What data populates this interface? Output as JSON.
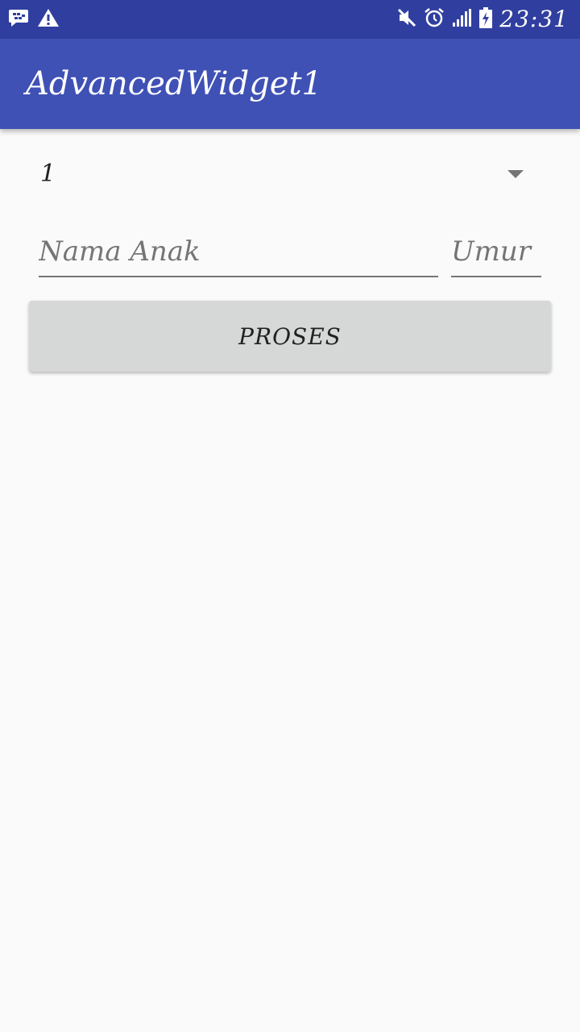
{
  "status_bar": {
    "time": "23:31",
    "icons": [
      "bbm-notification-icon",
      "warning-icon",
      "mute-icon",
      "alarm-icon",
      "signal-icon",
      "battery-charging-icon"
    ]
  },
  "app_bar": {
    "title": "AdvancedWidget1"
  },
  "spinner": {
    "selected_value": "1"
  },
  "form": {
    "name_placeholder": "Nama Anak",
    "name_value": "",
    "age_placeholder": "Umur",
    "age_value": ""
  },
  "button": {
    "label": "PROSES"
  },
  "colors": {
    "status_bar": "#303f9f",
    "app_bar": "#3f51b5",
    "background": "#fafafa",
    "button": "#d6d7d7"
  }
}
